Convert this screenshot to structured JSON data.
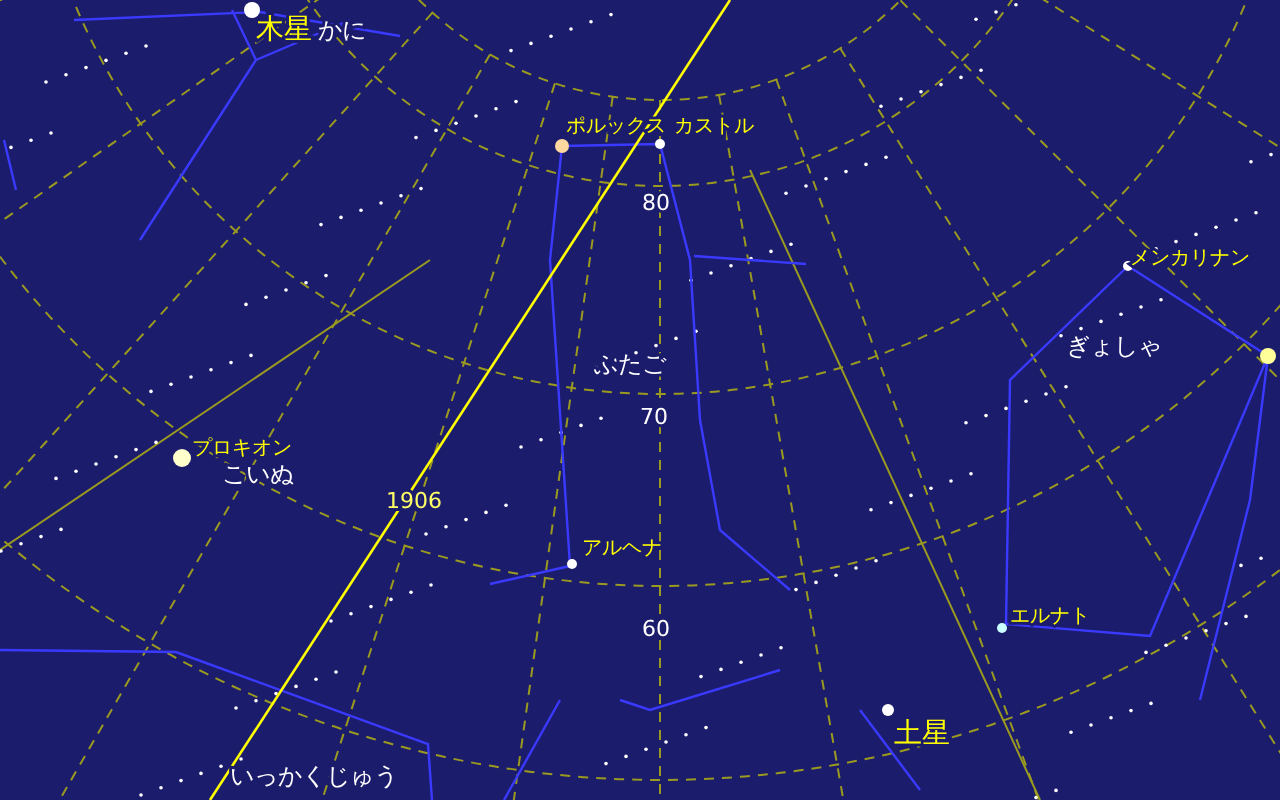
{
  "labels": [
    {
      "text": "木星",
      "kind": "planet"
    },
    {
      "text": "かに",
      "kind": "constellation"
    },
    {
      "text": "ポルックス",
      "kind": "star"
    },
    {
      "text": "カストル",
      "kind": "star"
    },
    {
      "text": "80",
      "kind": "grid"
    },
    {
      "text": "ふたご",
      "kind": "constellation"
    },
    {
      "text": "70",
      "kind": "grid"
    },
    {
      "text": "メンカリナン",
      "kind": "star"
    },
    {
      "text": "ぎょしゃ",
      "kind": "constellation"
    },
    {
      "text": "プロキオン",
      "kind": "star"
    },
    {
      "text": "こいぬ",
      "kind": "constellation"
    },
    {
      "text": "1906",
      "kind": "year"
    },
    {
      "text": "アルヘナ",
      "kind": "star"
    },
    {
      "text": "60",
      "kind": "grid"
    },
    {
      "text": "エルナト",
      "kind": "star"
    },
    {
      "text": "土星",
      "kind": "planet"
    },
    {
      "text": "いっかくじゅう",
      "kind": "constellation"
    }
  ]
}
